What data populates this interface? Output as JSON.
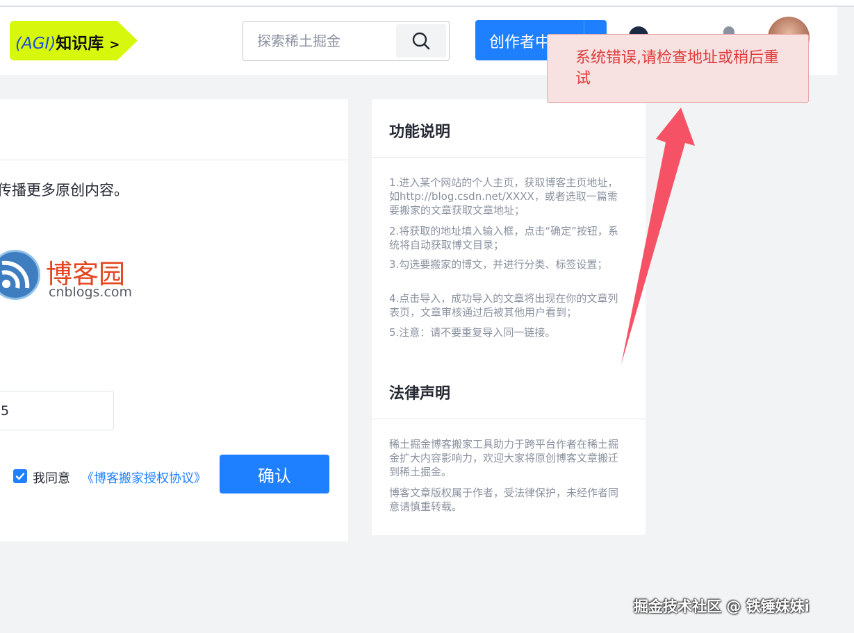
{
  "header": {
    "agi_badge": {
      "prefix": "(AGI)",
      "title": "知识库",
      "chevron": ">"
    },
    "search": {
      "placeholder": "探索稀土掘金"
    },
    "creator_button": "创作者中心"
  },
  "left_panel": {
    "intro_text": "传播更多原创内容。",
    "platform": {
      "name": "博客园",
      "domain": "cnblogs.com"
    },
    "url_input_value": "5",
    "agree_text": "我同意",
    "agreement_link": "《博客搬家授权协议》",
    "agree_checked": true,
    "confirm_button": "确认"
  },
  "right_panel": {
    "feature_title": "功能说明",
    "feature_items": [
      "1.进入某个网站的个人主页，获取博客主页地址，如http://blog.csdn.net/XXXX，或者选取一篇需要搬家的文章获取文章地址；",
      "2.将获取的地址填入输入框，点击“确定”按钮，系统将自动获取博文目录；",
      "3.勾选要搬家的博文，并进行分类、标签设置；",
      "4.点击导入，成功导入的文章将出现在你的文章列表页，文章审核通过后被其他用户看到；",
      "5.注意：请不要重复导入同一链接。"
    ],
    "legal_title": "法律声明",
    "legal_items": [
      "稀土掘金博客搬家工具助力于跨平台作者在稀土掘金扩大内容影响力，欢迎大家将原创博客文章搬迁到稀土掘金。",
      "博客文章版权属于作者，受法律保护，未经作者同意请慎重转载。"
    ]
  },
  "toast": {
    "message": "系统错误,请检查地址或稍后重试"
  },
  "watermark": "掘金技术社区 @ 铁锤妹妹i",
  "colors": {
    "primary": "#1e80ff",
    "error": "#e03b3b",
    "toast_bg": "#f7e1e1",
    "badge": "#d7f70d",
    "arrow": "#f55266"
  },
  "icons": [
    "search-icon",
    "bell-icon",
    "checkmark-icon",
    "rss-icon",
    "annotation-arrow"
  ]
}
